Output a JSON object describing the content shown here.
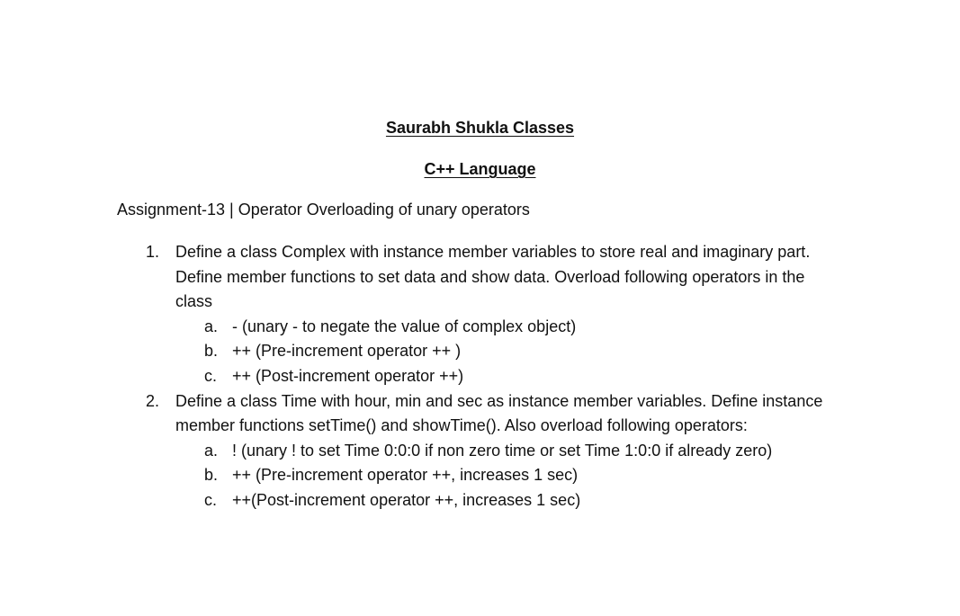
{
  "document": {
    "title": "Saurabh Shukla Classes",
    "subtitle": "C++ Language",
    "assignment": "Assignment-13 | Operator Overloading of unary operators",
    "questions": [
      {
        "number": "1.",
        "lines": [
          "Define a class Complex with instance member variables to store real and imaginary part.",
          "Define member functions to set data and show data. Overload following operators in the",
          "class"
        ],
        "items": [
          {
            "letter": "a.",
            "text": "- (unary - to negate the value of complex object)"
          },
          {
            "letter": "b.",
            "text": "++  (Pre-increment operator ++ )"
          },
          {
            "letter": "c.",
            "text": "++ (Post-increment operator ++)"
          }
        ]
      },
      {
        "number": "2.",
        "lines": [
          "Define a class Time with hour, min and sec as instance member variables. Define instance",
          "member functions setTime() and showTime(). Also overload following operators:"
        ],
        "items": [
          {
            "letter": "a.",
            "text": "! (unary ! to set Time 0:0:0 if non zero time or set Time 1:0:0 if already zero)"
          },
          {
            "letter": "b.",
            "text": "++ (Pre-increment operator ++, increases 1 sec)"
          },
          {
            "letter": "c.",
            "text": "++(Post-increment operator ++, increases 1 sec)"
          }
        ]
      }
    ]
  }
}
